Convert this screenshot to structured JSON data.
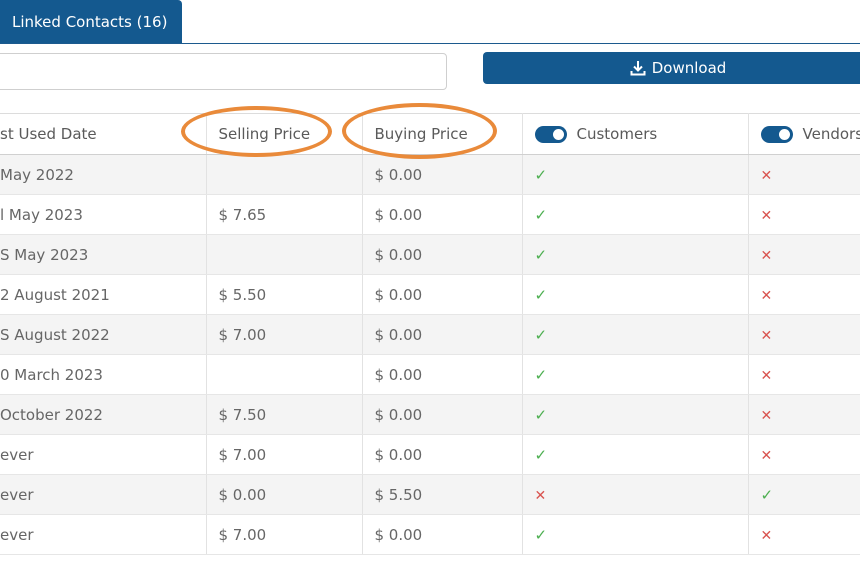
{
  "tab": {
    "label": "Linked Contacts (16)"
  },
  "search": {
    "value": "",
    "placeholder": ""
  },
  "download": {
    "label": "Download",
    "icon": "download-icon"
  },
  "table": {
    "headers": {
      "last_used_date": "st Used Date",
      "selling_price": "Selling Price",
      "buying_price": "Buying Price",
      "customers": "Customers",
      "vendors": "Vendors"
    },
    "rows": [
      {
        "date": "May 2022",
        "selling": "",
        "buying": "$ 0.00",
        "customer": "check",
        "vendor": "cross"
      },
      {
        "date": "l May 2023",
        "selling": "$ 7.65",
        "buying": "$ 0.00",
        "customer": "check",
        "vendor": "cross"
      },
      {
        "date": "S May 2023",
        "selling": "",
        "buying": "$ 0.00",
        "customer": "check",
        "vendor": "cross"
      },
      {
        "date": "2 August 2021",
        "selling": "$ 5.50",
        "buying": "$ 0.00",
        "customer": "check",
        "vendor": "cross"
      },
      {
        "date": "S August 2022",
        "selling": "$ 7.00",
        "buying": "$ 0.00",
        "customer": "check",
        "vendor": "cross"
      },
      {
        "date": "0 March 2023",
        "selling": "",
        "buying": "$ 0.00",
        "customer": "check",
        "vendor": "cross"
      },
      {
        "date": "October 2022",
        "selling": "$ 7.50",
        "buying": "$ 0.00",
        "customer": "check",
        "vendor": "cross"
      },
      {
        "date": "ever",
        "selling": "$ 7.00",
        "buying": "$ 0.00",
        "customer": "check",
        "vendor": "cross"
      },
      {
        "date": "ever",
        "selling": "$ 0.00",
        "buying": "$ 5.50",
        "customer": "cross",
        "vendor": "check"
      },
      {
        "date": "ever",
        "selling": "$ 7.00",
        "buying": "$ 0.00",
        "customer": "check",
        "vendor": "cross"
      }
    ]
  },
  "colors": {
    "primary": "#14598f",
    "highlight": "#e98a3a",
    "check": "#4caf50",
    "cross": "#d9534f"
  }
}
